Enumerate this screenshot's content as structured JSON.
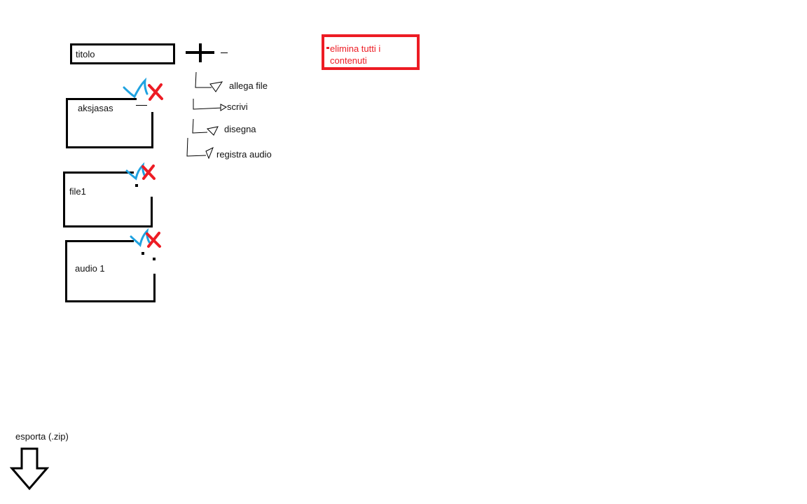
{
  "title_field": {
    "value": "titolo"
  },
  "add_menu": {
    "items": [
      {
        "label": "allega file"
      },
      {
        "label": "scrivi"
      },
      {
        "label": "disegna"
      },
      {
        "label": "registra audio"
      }
    ]
  },
  "delete_all": {
    "label": "elimina tutti i contenuti"
  },
  "notes": [
    {
      "label": "aksjasas"
    },
    {
      "label": "file1"
    },
    {
      "label": "audio 1"
    }
  ],
  "export": {
    "label": "esporta (.zip)"
  },
  "colors": {
    "accent_red": "#ed1c24",
    "check_blue": "#1fa2e0",
    "ink": "#000000"
  }
}
